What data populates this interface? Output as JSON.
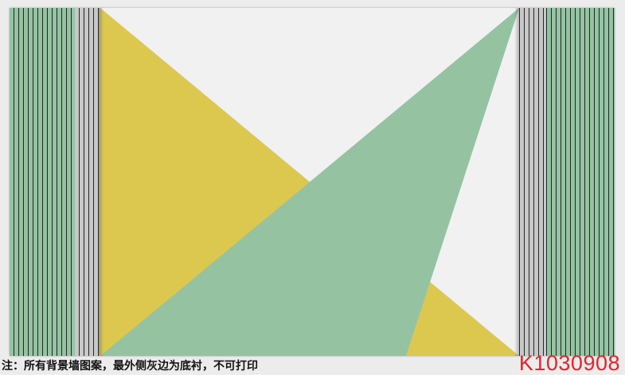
{
  "note": "注：所有背景墙图案，最外侧灰边为底衬，不可打印",
  "product_code": "K1030908",
  "colors": {
    "green": "#95c3a2",
    "yellow": "#dcc84f",
    "background": "#f1f1f1",
    "grey": "#c8c8c8",
    "stripe_line": "#1d2a22",
    "code_red": "#e8222a"
  }
}
